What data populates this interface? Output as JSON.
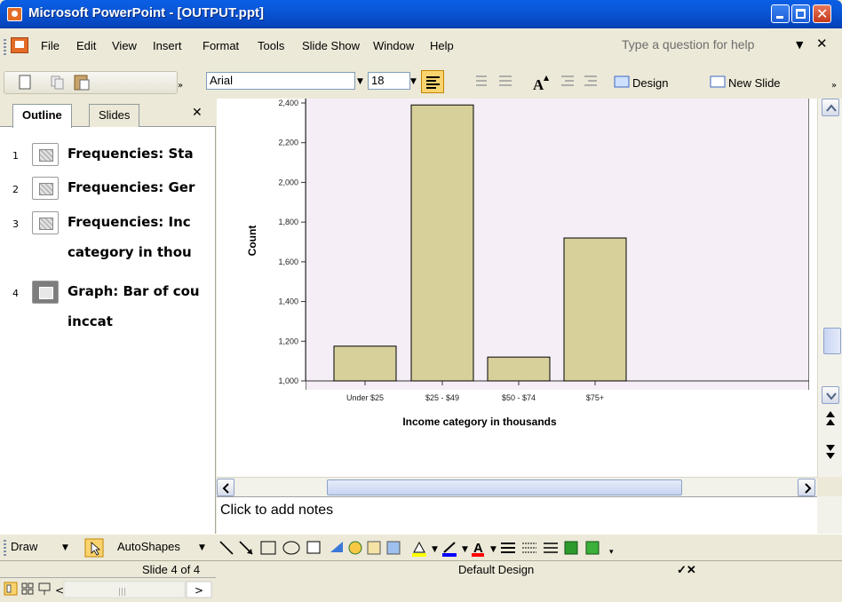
{
  "window": {
    "title": "Microsoft PowerPoint - [OUTPUT.ppt]"
  },
  "menu": {
    "items": [
      "File",
      "Edit",
      "View",
      "Insert",
      "Format",
      "Tools",
      "Slide Show",
      "Window",
      "Help"
    ],
    "help_placeholder": "Type a question for help"
  },
  "toolbar": {
    "font": "Arial",
    "size": "18",
    "design_label": "Design",
    "new_slide_label": "New Slide"
  },
  "outline": {
    "tabs": [
      "Outline",
      "Slides"
    ],
    "items": [
      {
        "num": "1",
        "lines": [
          "Frequencies: Sta"
        ]
      },
      {
        "num": "2",
        "lines": [
          "Frequencies: Ger"
        ]
      },
      {
        "num": "3",
        "lines": [
          "Frequencies: Inc",
          "category in thou"
        ]
      },
      {
        "num": "4",
        "lines": [
          "Graph: Bar of cou",
          "inccat"
        ]
      }
    ]
  },
  "notes": {
    "placeholder": "Click to add notes"
  },
  "drawbar": {
    "draw_label": "Draw",
    "autoshapes_label": "AutoShapes"
  },
  "status": {
    "slide": "Slide 4 of 4",
    "design": "Default Design"
  },
  "chart_data": {
    "type": "bar",
    "categories": [
      "Under $25",
      "$25 - $49",
      "$50 - $74",
      "$75+"
    ],
    "values": [
      1175,
      2390,
      1120,
      1720
    ],
    "ylabel": "Count",
    "xlabel": "Income category in thousands",
    "ylim": [
      1000,
      2400
    ],
    "yticks": [
      1000,
      1200,
      1400,
      1600,
      1800,
      2000,
      2200,
      2400
    ],
    "ytick_labels": [
      "1,000",
      "1,200",
      "1,400",
      "1,600",
      "1,800",
      "2,000",
      "2,200",
      "2,400"
    ],
    "bar_color": "#d8d09a"
  }
}
